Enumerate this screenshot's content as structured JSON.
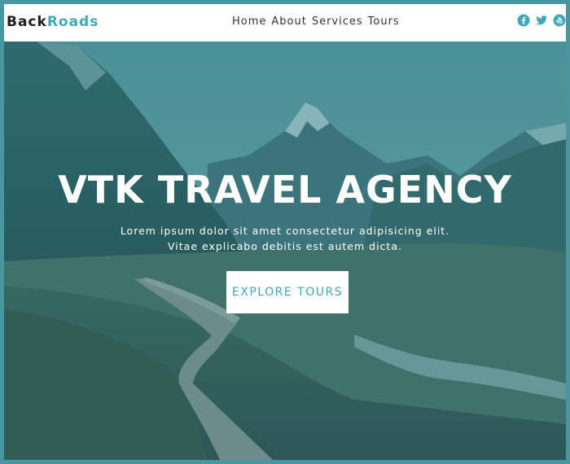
{
  "brand": {
    "part1": "Back",
    "part2": "Roads"
  },
  "nav": {
    "links": [
      {
        "label": "Home"
      },
      {
        "label": "About"
      },
      {
        "label": "Services"
      },
      {
        "label": "Tours"
      }
    ],
    "social_icons": [
      "facebook-icon",
      "twitter-icon",
      "squarespace-icon"
    ]
  },
  "hero": {
    "title": "VTK TRAVEL AGENCY",
    "subtitle": "Lorem ipsum dolor sit amet consectetur adipisicing elit. Vitae explicabo debitis est autem dicta.",
    "cta_label": "EXPLORE TOURS"
  },
  "colors": {
    "accent": "#40a9b8",
    "frame": "#4a96a0",
    "overlay": "#2e7f87"
  }
}
